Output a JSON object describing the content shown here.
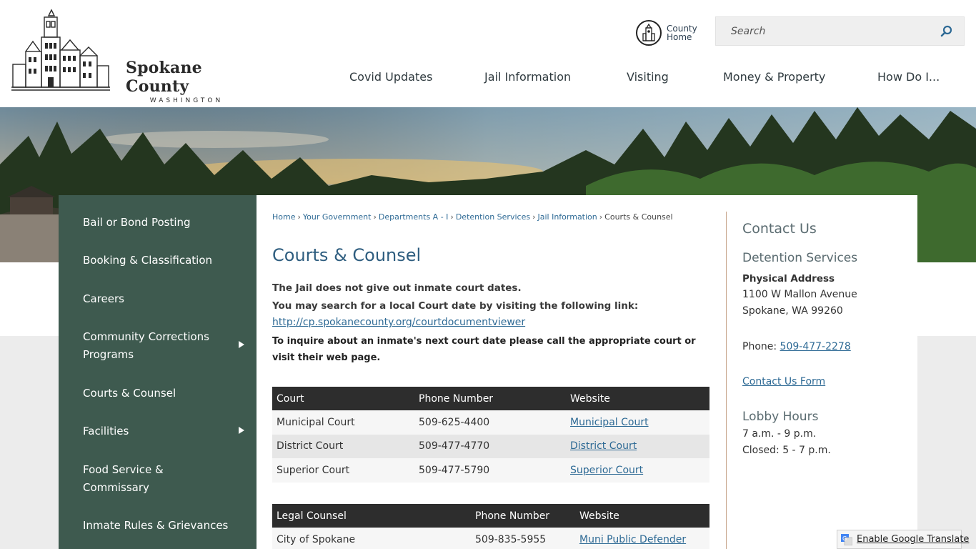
{
  "header": {
    "logo_title": "Spokane County",
    "logo_subtitle": "WASHINGTON",
    "county_home_label_1": "County",
    "county_home_label_2": "Home",
    "search_placeholder": "Search"
  },
  "nav": {
    "items": [
      "Covid Updates",
      "Jail Information",
      "Visiting",
      "Money & Property",
      "How Do I..."
    ]
  },
  "sidebar": {
    "items": [
      {
        "label": "Bail or Bond Posting",
        "has_submenu": false
      },
      {
        "label": "Booking & Classification",
        "has_submenu": false
      },
      {
        "label": "Careers",
        "has_submenu": false
      },
      {
        "label": "Community Corrections Programs",
        "has_submenu": true
      },
      {
        "label": "Courts & Counsel",
        "has_submenu": false
      },
      {
        "label": "Facilities",
        "has_submenu": true
      },
      {
        "label": "Food Service & Commissary",
        "has_submenu": false
      },
      {
        "label": "Inmate Rules & Grievances",
        "has_submenu": false
      }
    ]
  },
  "breadcrumb": [
    "Home",
    "Your Government",
    "Departments A - I",
    "Detention Services",
    "Jail Information",
    "Courts & Counsel"
  ],
  "content": {
    "title": "Courts & Counsel",
    "line1": "The Jail does not give out inmate court dates.",
    "line2": "You may search for a local Court date by visiting the following link:",
    "link": "http://cp.spokanecounty.org/courtdocumentviewer",
    "line3": "To inquire about an inmate's next court date please call the appropriate court or visit their web page."
  },
  "courts_table": {
    "headers": [
      "Court",
      "Phone Number",
      "Website"
    ],
    "rows": [
      [
        "Municipal Court",
        "509-625-4400",
        "Municipal Court"
      ],
      [
        "District Court",
        "509-477-4770",
        "District Court"
      ],
      [
        "Superior Court",
        "509-477-5790",
        "Superior Court"
      ]
    ]
  },
  "counsel_table": {
    "headers": [
      "Legal Counsel",
      "Phone Number",
      "Website"
    ],
    "rows": [
      [
        "City of Spokane",
        "509-835-5955",
        "Muni Public Defender"
      ]
    ]
  },
  "contact": {
    "heading": "Contact Us",
    "department": "Detention Services",
    "address_label": "Physical Address",
    "address_line1": "1100 W Mallon Avenue",
    "address_line2": "Spokane, WA 99260",
    "phone_label": "Phone: ",
    "phone": "509-477-2278",
    "form_link": "Contact Us Form",
    "hours_heading": "Lobby Hours",
    "hours_line1": "7 a.m. - 9 p.m.",
    "hours_line2": "Closed: 5 - 7 p.m."
  },
  "translate": {
    "label": "Enable Google Translate"
  },
  "colors": {
    "sidebar_bg": "#3e5a4f",
    "heading": "#2e5d7f",
    "link": "#2e6a95",
    "table_header": "#2d2d2d"
  }
}
